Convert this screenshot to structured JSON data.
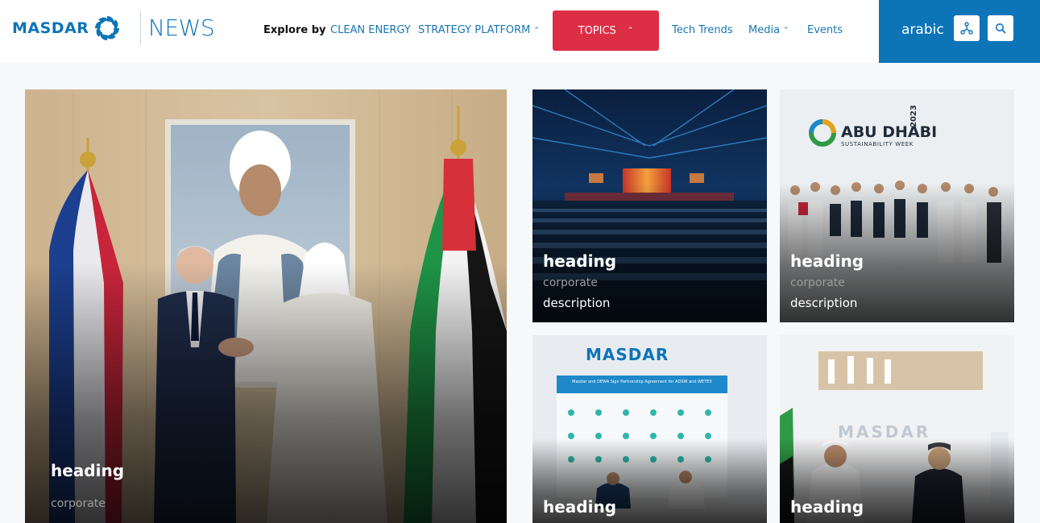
{
  "header": {
    "logo_text": "MASDAR",
    "news_label": "NEWS",
    "explore_label": "Explore by",
    "nav": {
      "clean_energy": "CLEAN ENERGY",
      "strategy_platform": "STRATEGY PLATFORM",
      "topics": "TOPICS",
      "tech_trends": "Tech Trends",
      "media": "Media",
      "events": "Events"
    },
    "language": "arabic",
    "icons": {
      "share": "share-icon",
      "search": "search-icon",
      "caret": "chevron-up-icon"
    }
  },
  "colors": {
    "brand_blue": "#0d74b8",
    "topics_red": "#dc2e45",
    "page_bg": "#f7f8fa"
  },
  "cards": {
    "featured": {
      "heading": "heading",
      "tag": "corporate"
    },
    "top_middle": {
      "heading": "heading",
      "tag": "corporate",
      "description": "description"
    },
    "top_right": {
      "heading": "heading",
      "tag": "corporate",
      "description": "description",
      "poster_title": "ABU DHABI",
      "poster_subtitle": "SUSTAINABILITY WEEK",
      "poster_year": "2023"
    },
    "bottom_middle": {
      "heading": "heading",
      "backdrop_brand": "MASDAR",
      "banner_line": "Masdar and DEWA Sign Partnership Agreement for ADSW and WETEX"
    },
    "bottom_right": {
      "heading": "heading",
      "backdrop_brand": "MASDAR"
    }
  }
}
